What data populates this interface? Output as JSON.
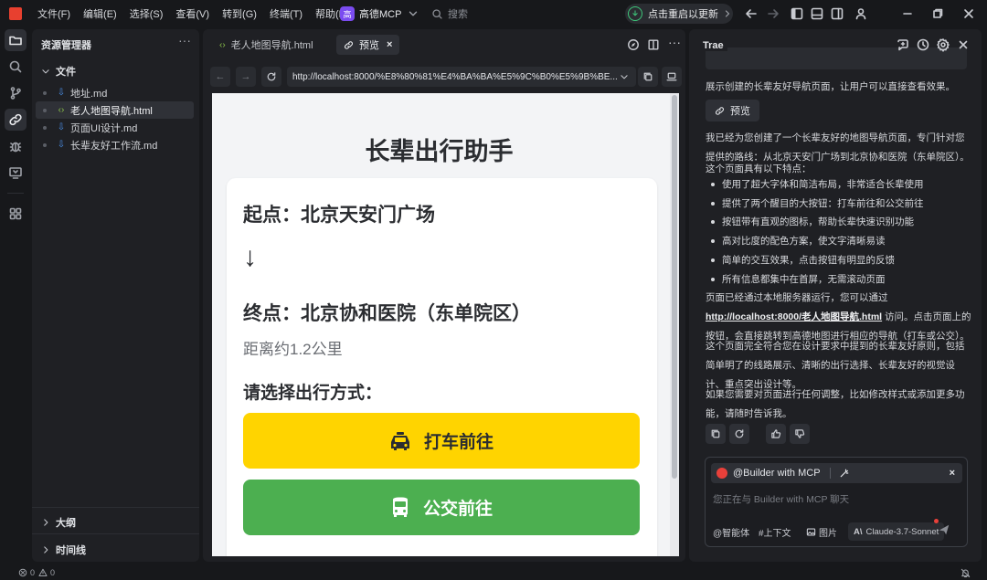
{
  "titlebar": {
    "menu": [
      "文件(F)",
      "编辑(E)",
      "选择(S)",
      "查看(V)",
      "转到(G)",
      "终端(T)",
      "帮助(H)"
    ],
    "mcp_name": "高德MCP",
    "mcp_logo_text": "高",
    "search_placeholder": "搜索",
    "update_label": "点击重启以更新"
  },
  "explorer": {
    "title": "资源管理器",
    "more": "···",
    "files_section": "文件",
    "files": [
      {
        "name": "地址.md",
        "type": "md"
      },
      {
        "name": "老人地图导航.html",
        "type": "html",
        "active": true
      },
      {
        "name": "页面UI设计.md",
        "type": "md"
      },
      {
        "name": "长辈友好工作流.md",
        "type": "md"
      }
    ],
    "outline_section": "大纲",
    "timeline_section": "时间线"
  },
  "editor": {
    "tabs": [
      {
        "label": "老人地图导航.html",
        "icon": "code-icon"
      },
      {
        "label": "预览",
        "icon": "link-icon",
        "active": true
      }
    ],
    "url": "http://localhost:8000/%E8%80%81%E4%BA%BA%E5%9C%B0%E5%9B%BE..."
  },
  "preview": {
    "title": "长辈出行助手",
    "start": "起点：北京天安门广场",
    "arrow": "↓",
    "end": "终点：北京协和医院（东单院区）",
    "distance": "距离约1.2公里",
    "choose": "请选择出行方式：",
    "taxi_label": "打车前往",
    "bus_label": "公交前往"
  },
  "chat": {
    "title": "Trae",
    "intro": "展示创建的长辈友好导航页面，让用户可以直接查看效果。",
    "preview_button": "预览",
    "para1": "我已经为您创建了一个长辈友好的地图导航页面，专门针对您提供的路线：从北京天安门广场到北京协和医院（东单院区）。",
    "para2": "这个页面具有以下特点：",
    "bullets": [
      "使用了超大字体和简洁布局，非常适合长辈使用",
      "提供了两个醒目的大按钮：打车前往和公交前往",
      "按钮带有直观的图标，帮助长辈快速识别功能",
      "高对比度的配色方案，使文字清晰易读",
      "简单的交互效果，点击按钮有明显的反馈",
      "所有信息都集中在首屏，无需滚动页面"
    ],
    "para3_pre": "页面已经通过本地服务器运行，您可以通过 ",
    "para3_link": "http://localhost:8000/老人地图导航.html",
    "para3_post": " 访问。点击页面上的按钮，会直接跳转到高德地图进行相应的导航（打车或公交）。",
    "para4": "这个页面完全符合您在设计要求中提到的长辈友好原则，包括简单明了的线路展示、清晰的出行选择、长辈友好的视觉设计、重点突出设计等。",
    "para5": "如果您需要对页面进行任何调整，比如修改样式或添加更多功能，请随时告诉我。",
    "composer": {
      "mcp_tag": "@Builder with MCP",
      "placeholder": "您正在与 Builder with MCP 聊天",
      "tools": [
        "@智能体",
        "#上下文",
        "图片"
      ],
      "model": "Claude-3.7-Sonnet"
    }
  },
  "statusbar": {
    "errors": "0",
    "warnings": "0"
  }
}
